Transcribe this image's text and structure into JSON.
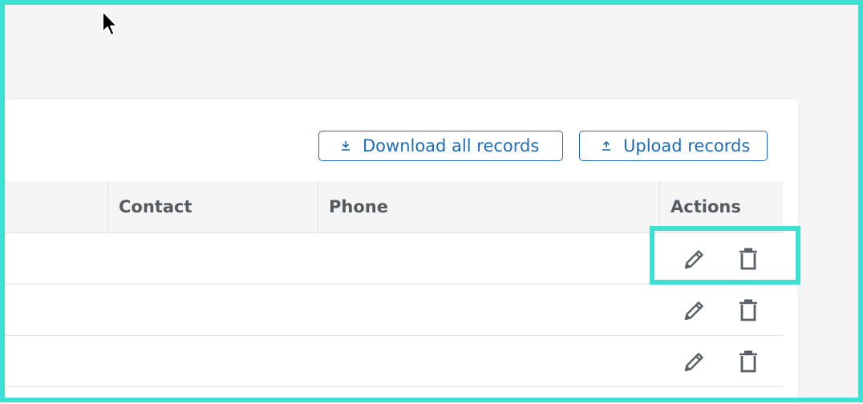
{
  "toolbar": {
    "download_label": "Download all records",
    "download_icon": "download-icon",
    "upload_label": "Upload records",
    "upload_icon": "upload-icon"
  },
  "table": {
    "columns": [
      "",
      "Contact",
      "Phone",
      "Actions"
    ],
    "rows": [
      {
        "contact": "",
        "phone": "",
        "actions": [
          "edit-icon",
          "delete-icon"
        ]
      },
      {
        "contact": "",
        "phone": "",
        "actions": [
          "edit-icon",
          "delete-icon"
        ]
      },
      {
        "contact": "",
        "phone": "",
        "actions": [
          "edit-icon",
          "delete-icon"
        ]
      }
    ]
  },
  "colors": {
    "accent": "#1f6bb5",
    "highlight": "#3ee0d3",
    "icon": "#5a5f66",
    "header_bg": "#f5f5f5",
    "page_bg": "#f5f5f5"
  }
}
